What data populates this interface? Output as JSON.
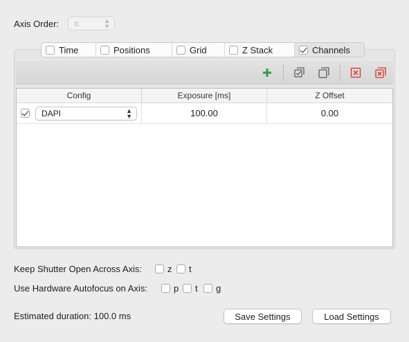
{
  "axis_order": {
    "label": "Axis Order:",
    "value": "c"
  },
  "tabs": [
    {
      "label": "Time",
      "checked": false
    },
    {
      "label": "Positions",
      "checked": false
    },
    {
      "label": "Grid",
      "checked": false
    },
    {
      "label": "Z Stack",
      "checked": false
    },
    {
      "label": "Channels",
      "checked": true
    }
  ],
  "toolbar": {
    "icons": [
      "add-icon",
      "check-all-icon",
      "duplicate-icon",
      "remove-icon",
      "clear-all-icon"
    ],
    "colors": {
      "add": "#2ea043",
      "remove": "#d9342b",
      "neutral": "#5a5a5a"
    }
  },
  "table": {
    "headers": [
      "Config",
      "Exposure [ms]",
      "Z Offset"
    ],
    "rows": [
      {
        "checked": true,
        "config": "DAPI",
        "exposure": "100.00",
        "z_offset": "0.00"
      }
    ]
  },
  "shutter": {
    "label": "Keep Shutter Open Across Axis:",
    "options": [
      {
        "label": "z",
        "checked": false
      },
      {
        "label": "t",
        "checked": false
      }
    ]
  },
  "autofocus": {
    "label": "Use Hardware Autofocus on Axis:",
    "options": [
      {
        "label": "p",
        "checked": false
      },
      {
        "label": "t",
        "checked": false
      },
      {
        "label": "g",
        "checked": false
      }
    ]
  },
  "footer": {
    "duration": "Estimated duration: 100.0 ms",
    "save_label": "Save Settings",
    "load_label": "Load Settings"
  }
}
